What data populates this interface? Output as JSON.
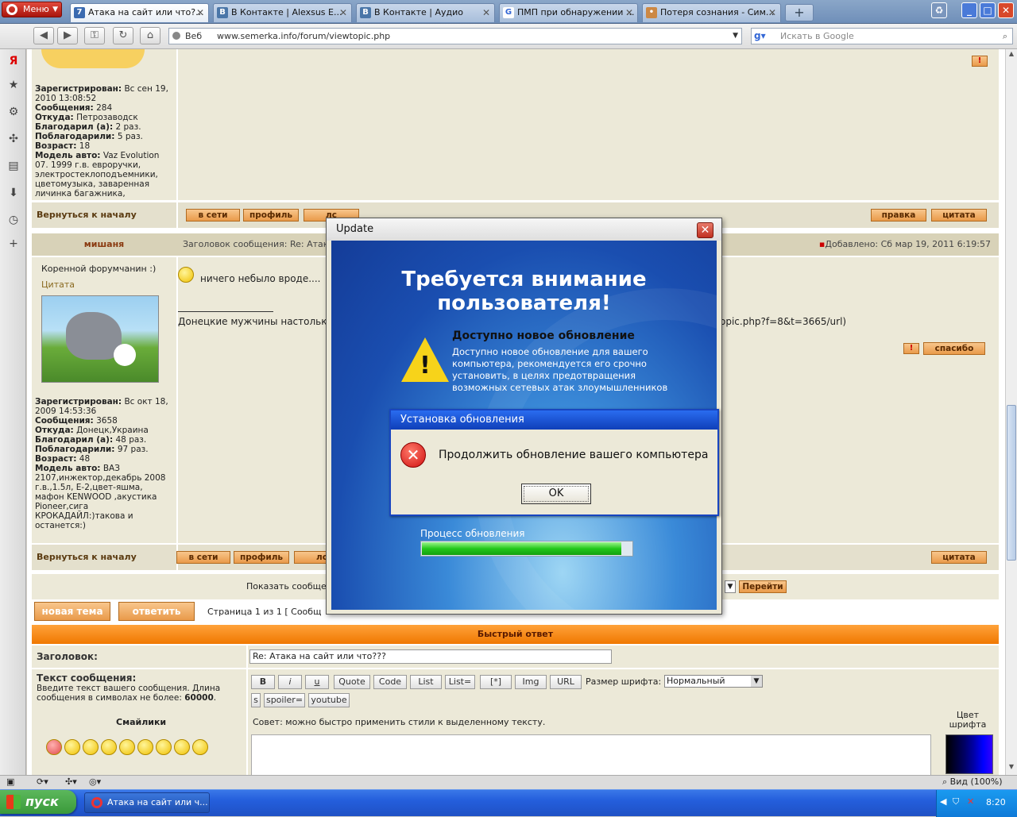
{
  "browser": {
    "menu_label": "Меню",
    "tabs": [
      {
        "label": "Атака на сайт или что?...",
        "icon": "forum-icon"
      },
      {
        "label": "В Контакте | Alexsus E...",
        "icon": "vk-icon"
      },
      {
        "label": "В Контакте | Аудио",
        "icon": "vk-icon"
      },
      {
        "label": "ПМП при обнаружении ...",
        "icon": "google-icon"
      },
      {
        "label": "Потеря сознания - Сим...",
        "icon": "page-icon"
      }
    ],
    "address": {
      "prefix": "Веб",
      "url": "www.semerka.info/forum/viewtopic.php"
    },
    "search_placeholder": "Искать в Google"
  },
  "forum": {
    "post1_profile": {
      "reg_label": "Зарегистрирован:",
      "reg_value": "Вс сен 19, 2010 13:08:52",
      "msgs_label": "Сообщения:",
      "msgs_value": "284",
      "from_label": "Откуда:",
      "from_value": "Петрозаводск",
      "thanked_label": "Благодарил (а):",
      "thanked_value": "2 раз.",
      "got_thanks_label": "Поблагодарили:",
      "got_thanks_value": "5 раз.",
      "age_label": "Возраст:",
      "age_value": "18",
      "car_label": "Модель авто:",
      "car_value": "Vaz Evolution 07. 1999 г.в. евроручки, электростеклоподъемники, цветомузыка, заваренная личинка багажника,"
    },
    "back_to_top": "Вернуться к началу",
    "btn_online": "в сети",
    "btn_profile": "профиль",
    "btn_pm": "лс",
    "btn_edit": "правка",
    "btn_quote": "цитата",
    "post2": {
      "author": "мишаня",
      "subject": "Заголовок сообщения: Re: Атак",
      "added": "Добавлено: Сб мар 19, 2011 6:19:57",
      "rank": "Коренной форумчанин :)",
      "quote_link": "Цитата",
      "text1": "ничего небыло вроде....",
      "sig_text": "Донецкие мужчины настолько",
      "sig_tail": "opic.php?f=8&t=3665/url)",
      "thanks": "спасибо",
      "profile": {
        "reg_label": "Зарегистрирован:",
        "reg_value": "Вс окт 18, 2009 14:53:36",
        "msgs_label": "Сообщения:",
        "msgs_value": "3658",
        "from_label": "Откуда:",
        "from_value": "Донецк,Украина",
        "thanked_label": "Благодарил (а):",
        "thanked_value": "48 раз.",
        "got_thanks_label": "Поблагодарили:",
        "got_thanks_value": "97 раз.",
        "age_label": "Возраст:",
        "age_value": "48",
        "car_label": "Модель авто:",
        "car_value": "ВАЗ 2107,инжектор,декабрь 2008 г.в.,1.5л, Е-2,цвет-яшма, мафон KENWOOD ,акустика Pioneer,сига КРОКАДАЙЛ:)такова и останется:)"
      }
    },
    "show_msgs": "Показать сообще",
    "go_btn": "Перейти",
    "new_topic": "новая тема",
    "reply": "ответить",
    "pagination": "Страница 1 из 1   [ Сообщ"
  },
  "quick_reply": {
    "title": "Быстрый ответ",
    "subject_label": "Заголовок:",
    "subject_value": "Re: Атака на сайт или что???",
    "text_label": "Текст сообщения:",
    "text_hint": "Введите текст вашего сообщения. Длина сообщения в символах не более:",
    "max_len": "60000",
    "smilies_label": "Смайлики",
    "toolbar": [
      "B",
      "i",
      "u",
      "Quote",
      "Code",
      "List",
      "List=",
      "[*]",
      "Img",
      "URL"
    ],
    "toolbar2": [
      "s",
      "spoiler=",
      "youtube"
    ],
    "font_size_label": "Размер шрифта:",
    "font_size_value": "Нормальный",
    "tip": "Совет: можно быстро применить стили к выделенному тексту.",
    "color_label": "Цвет шрифта"
  },
  "popup": {
    "title": "Update",
    "heading": "Требуется внимание пользователя!",
    "update_title": "Доступно новое обновление",
    "update_desc": "Доступно новое обновление для вашего компьютера, рекомендуется его срочно установить, в целях предотвращения возможных сетевых атак злоумышленников",
    "progress_label": "Процесс обновления",
    "progress_value": 0.95,
    "dialog": {
      "title": "Установка обновления",
      "message": "Продолжить обновление вашего компьютера",
      "ok": "OK"
    }
  },
  "status": {
    "zoom": "Вид (100%)"
  },
  "taskbar": {
    "start": "пуск",
    "item": "Атака на сайт или ч...",
    "clock": "8:20"
  },
  "colors": {
    "accent_orange": "#f07800",
    "forum_bg": "#ece9d8",
    "xp_blue": "#245edc"
  }
}
